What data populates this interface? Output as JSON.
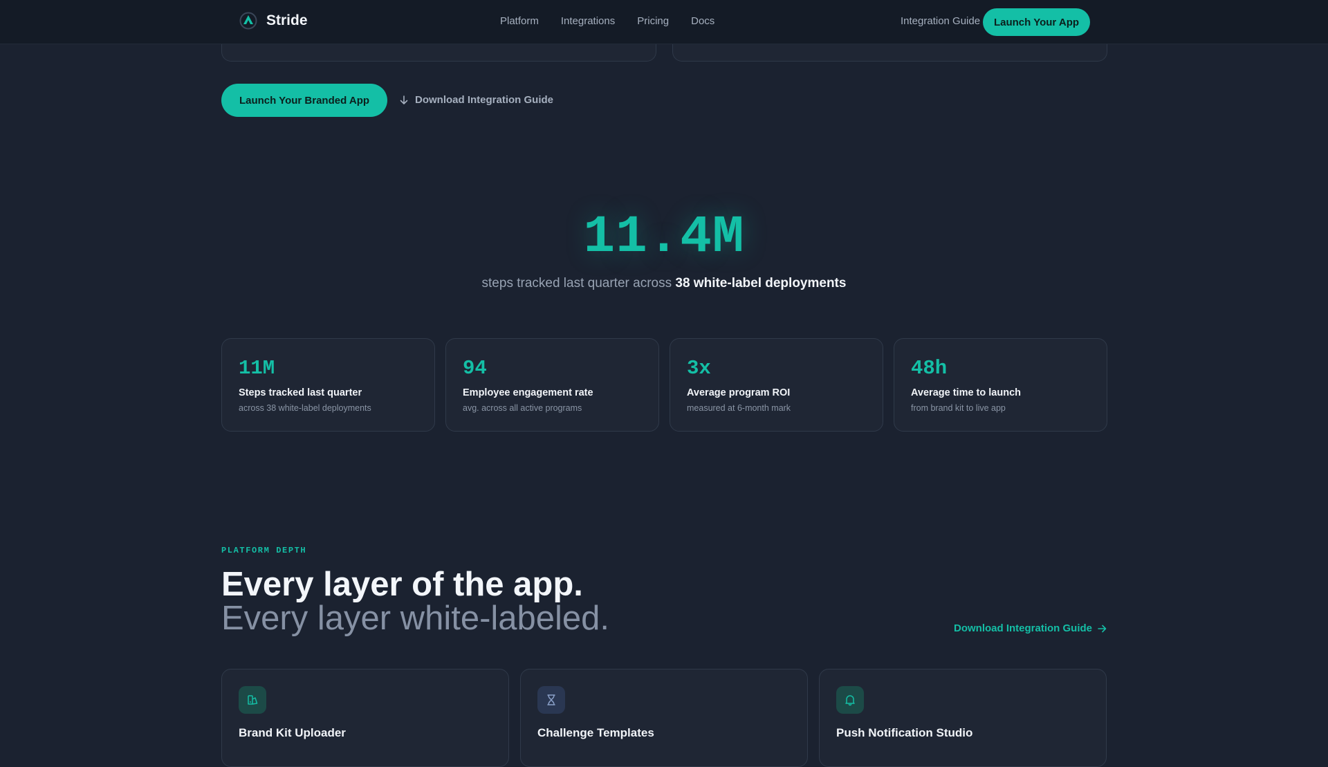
{
  "nav": {
    "brand": "Stride",
    "links": [
      "Platform",
      "Integrations",
      "Pricing",
      "Docs"
    ],
    "guide": "Integration Guide",
    "cta": "Launch Your App"
  },
  "hero_actions": {
    "primary": "Launch Your Branded App",
    "secondary": "Download Integration Guide"
  },
  "metric": {
    "value": "11.4M",
    "caption_plain": "steps tracked last quarter across",
    "caption_bold": "38 white-label deployments"
  },
  "stats": [
    {
      "value": "11M",
      "label": "Steps tracked last quarter",
      "sub": "across 38 white-label deployments"
    },
    {
      "value": "94",
      "label": "Employee engagement rate",
      "sub": "avg. across all active programs"
    },
    {
      "value": "3x",
      "label": "Average program ROI",
      "sub": "measured at 6-month mark"
    },
    {
      "value": "48h",
      "label": "Average time to launch",
      "sub": "from brand kit to live app"
    }
  ],
  "platform": {
    "eyebrow": "PLATFORM DEPTH",
    "headline": "Every layer of the app.",
    "subheadline": "Every layer white-labeled.",
    "link": "Download Integration Guide"
  },
  "features": [
    {
      "title": "Brand Kit Uploader",
      "icon": "brand-kit-icon"
    },
    {
      "title": "Challenge Templates",
      "icon": "hourglass-icon"
    },
    {
      "title": "Push Notification Studio",
      "icon": "bell-icon"
    }
  ],
  "colors": {
    "accent": "#14bfa6",
    "background": "#1b2230",
    "nav_background": "#141b26",
    "card_background": "#1f2634"
  }
}
